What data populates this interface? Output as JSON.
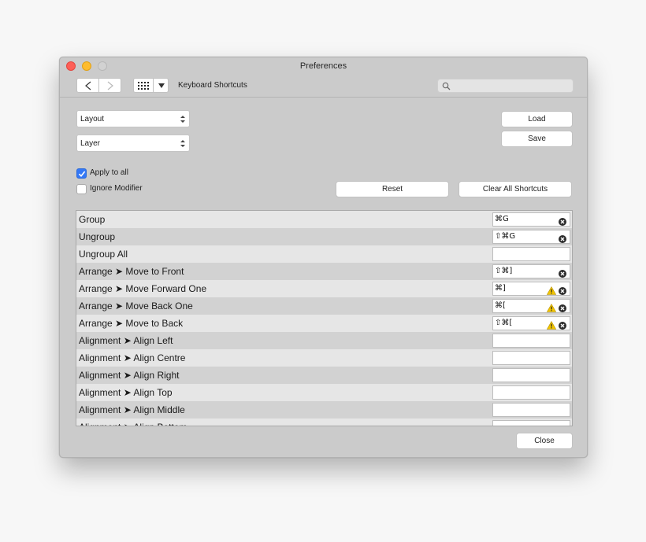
{
  "window": {
    "title": "Preferences"
  },
  "toolbar": {
    "page_heading": "Keyboard Shortcuts",
    "search_placeholder": ""
  },
  "selects": {
    "layout": "Layout",
    "layer": "Layer"
  },
  "buttons": {
    "load": "Load",
    "save": "Save",
    "reset": "Reset",
    "clear_all": "Clear All Shortcuts",
    "close": "Close"
  },
  "options": {
    "apply_to_all": {
      "label": "Apply to all",
      "checked": true
    },
    "ignore_modifier": {
      "label": "Ignore Modifier",
      "checked": false
    }
  },
  "colors": {
    "accent": "#3478f6",
    "warning": "#f2c500",
    "close_red": "#fe5f57",
    "minimize_yellow": "#febc2e"
  },
  "shortcuts": [
    {
      "name": "Group",
      "keys": "⌘G",
      "warning": false,
      "clear": true
    },
    {
      "name": "Ungroup",
      "keys": "⇧⌘G",
      "warning": false,
      "clear": true
    },
    {
      "name": "Ungroup All",
      "keys": "",
      "warning": false,
      "clear": false
    },
    {
      "name": "Arrange ➤ Move to Front",
      "keys": "⇧⌘]",
      "warning": false,
      "clear": true
    },
    {
      "name": "Arrange ➤ Move Forward One",
      "keys": "⌘]",
      "warning": true,
      "clear": true
    },
    {
      "name": "Arrange ➤ Move Back One",
      "keys": "⌘[",
      "warning": true,
      "clear": true
    },
    {
      "name": "Arrange ➤ Move to Back",
      "keys": "⇧⌘[",
      "warning": true,
      "clear": true
    },
    {
      "name": "Alignment ➤ Align Left",
      "keys": "",
      "warning": false,
      "clear": false
    },
    {
      "name": "Alignment ➤ Align Centre",
      "keys": "",
      "warning": false,
      "clear": false
    },
    {
      "name": "Alignment ➤ Align Right",
      "keys": "",
      "warning": false,
      "clear": false
    },
    {
      "name": "Alignment ➤ Align Top",
      "keys": "",
      "warning": false,
      "clear": false
    },
    {
      "name": "Alignment ➤ Align Middle",
      "keys": "",
      "warning": false,
      "clear": false
    },
    {
      "name": "Alignment ➤ Align Bottom",
      "keys": "",
      "warning": false,
      "clear": false
    }
  ]
}
